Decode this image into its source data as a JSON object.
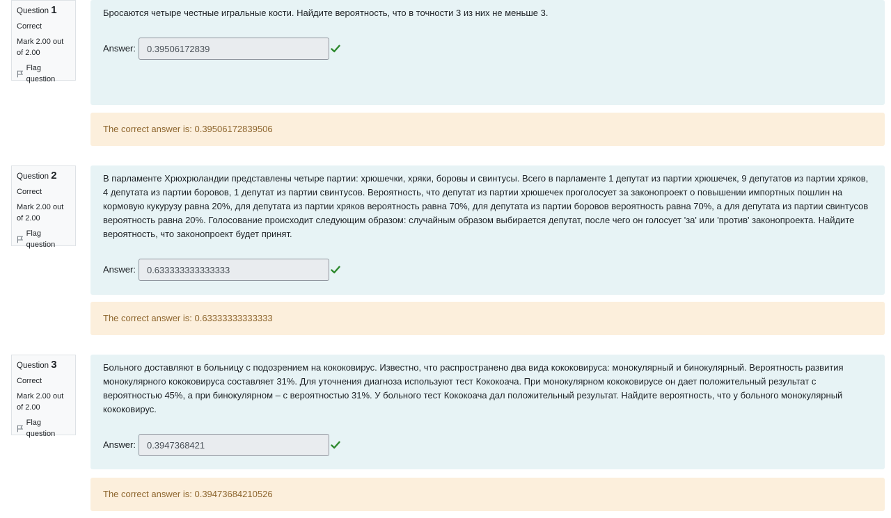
{
  "questions": [
    {
      "label": "Question",
      "number": "1",
      "state": "Correct",
      "mark": "Mark 2.00 out of 2.00",
      "flag": "Flag question",
      "text": "Бросаются четыре честные игральные кости. Найдите вероятность, что в точности 3 из них не меньше 3.",
      "answer_label": "Answer:",
      "answer_value": "0.39506172839",
      "feedback": "The correct answer is: 0.39506172839506"
    },
    {
      "label": "Question",
      "number": "2",
      "state": "Correct",
      "mark": "Mark 2.00 out of 2.00",
      "flag": "Flag question",
      "text": "В парламенте Хрюхрюландии представлены четыре партии: хрюшечки, хряки, боровы и свинтусы. Всего в парламенте 1 депутат из партии хрюшечек, 9 депутатов из партии хряков, 4 депутата из партии боровов, 1 депутат из партии свинтусов. Вероятность, что депутат из партии хрюшечек проголосует за законопроект о повышении импортных пошлин на кормовую кукурузу равна 20%, для депутата из партии хряков вероятность равна 70%, для депутата из партии боровов вероятность равна 70%, а для депутата из партии свинтусов вероятность равна 20%. Голосование происходит следующим образом: случайным образом выбирается депутат, после чего он голосует 'за' или 'против' законопроекта. Найдите вероятность, что законопроект будет принят.",
      "answer_label": "Answer:",
      "answer_value": "0.633333333333333",
      "feedback": "The correct answer is: 0.63333333333333"
    },
    {
      "label": "Question",
      "number": "3",
      "state": "Correct",
      "mark": "Mark 2.00 out of 2.00",
      "flag": "Flag question",
      "text": "Больного доставляют в больницу с подозрением на кококовирус. Известно, что распространено два вида кококовируса: монокулярный и бинокулярный. Вероятность развития монокулярного кококовируса составляет 31%. Для уточнения диагноза используют тест Кококоача. При монокулярном кококовирусе он дает положительный результат с вероятностью 45%, а при бинокулярном – с вероятностью 31%. У больного тест Кококоача дал положительный результат. Найдите вероятность, что у больного монокулярный кококовирус.",
      "answer_label": "Answer:",
      "answer_value": "0.3947368421",
      "feedback": "The correct answer is: 0.39473684210526"
    }
  ],
  "colors": {
    "formulation_bg": "#e7f3f5",
    "feedback_bg": "#fcefdc",
    "feedback_text": "#8e662e",
    "check": "#357a32"
  },
  "icons": {
    "flag": "flag-icon",
    "correct": "check-icon"
  }
}
